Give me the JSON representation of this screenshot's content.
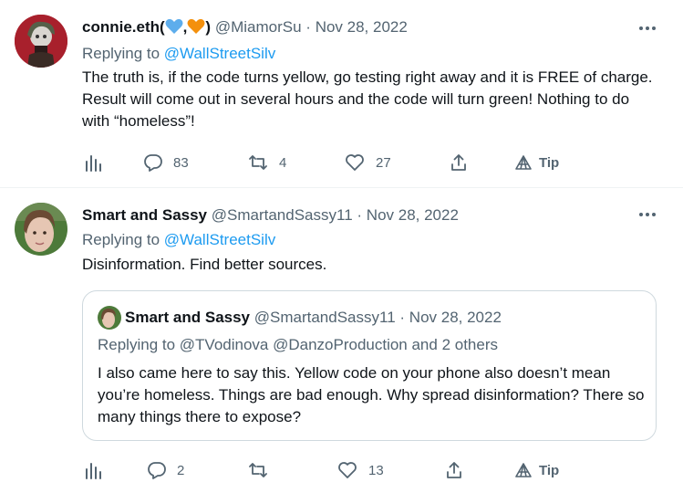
{
  "colors": {
    "link": "#1d9bf0",
    "muted": "#536471",
    "text": "#0f1419",
    "divider": "#eff3f4"
  },
  "tweets": [
    {
      "display_name": "connie.eth(",
      "display_name_sep": ",",
      "display_name_end": ")",
      "emoji_1": "blue-heart",
      "emoji_2": "orange-heart",
      "handle": "@MiamorSu",
      "dot": "·",
      "date": "Nov 28, 2022",
      "replying_prefix": "Replying to",
      "replying_to": "@WallStreetSilv",
      "text": "The truth is, if the code turns yellow, go testing right away and it is FREE of charge. Result will come out in several hours and the code will turn green! Nothing to do with “homeless”!",
      "actions": {
        "replies": "83",
        "retweets": "4",
        "likes": "27",
        "tip": "Tip"
      }
    },
    {
      "display_name": "Smart and Sassy",
      "handle": "@SmartandSassy11",
      "dot": "·",
      "date": "Nov 28, 2022",
      "replying_prefix": "Replying to",
      "replying_to": "@WallStreetSilv",
      "text": "Disinformation. Find better sources.",
      "quoted": {
        "display_name": "Smart and Sassy",
        "handle": "@SmartandSassy11",
        "dot": "·",
        "date": "Nov 28, 2022",
        "replying_line": "Replying to @TVodinova @DanzoProduction and 2 others",
        "text": "I also came here to say this. Yellow code on your phone also doesn’t mean you’re homeless. Things are bad enough. Why spread disinformation? There so many things there to expose?"
      },
      "actions": {
        "replies": "2",
        "retweets": "",
        "likes": "13",
        "tip": "Tip"
      }
    }
  ]
}
